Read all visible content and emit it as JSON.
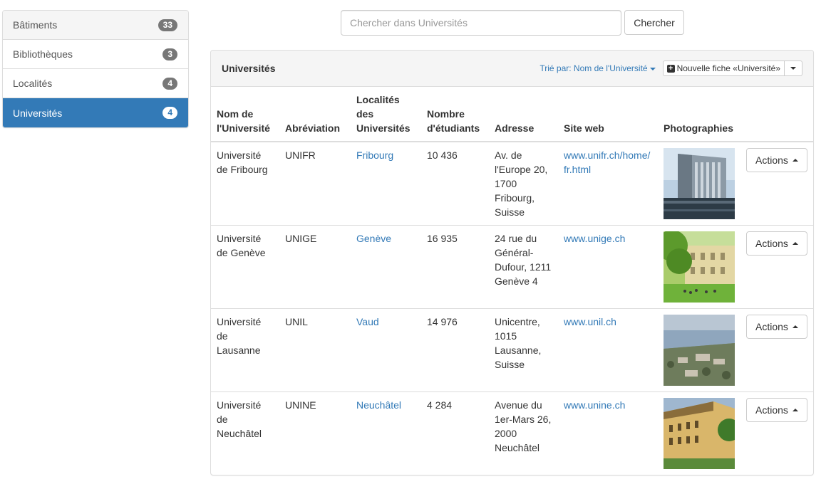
{
  "sidebar": {
    "items": [
      {
        "label": "Bâtiments",
        "count": "33"
      },
      {
        "label": "Bibliothèques",
        "count": "3"
      },
      {
        "label": "Localités",
        "count": "4"
      },
      {
        "label": "Universités",
        "count": "4"
      }
    ],
    "active_index": 3
  },
  "search": {
    "placeholder": "Chercher dans Universités",
    "value": "",
    "button_label": "Chercher"
  },
  "panel": {
    "title": "Universités",
    "sort_label": "Trié par: Nom de l'Université",
    "new_button_label": "Nouvelle fiche «Université»"
  },
  "table": {
    "headers": {
      "name": "Nom de l'Université",
      "abbr": "Abréviation",
      "loc": "Localités des Universités",
      "students": "Nombre d'étudiants",
      "address": "Adresse",
      "website": "Site web",
      "photos": "Photographies"
    },
    "rows": [
      {
        "name": "Université de Fribourg",
        "abbr": "UNIFR",
        "loc": "Fribourg",
        "students": "10 436",
        "address": "Av. de l'Europe 20, 1700 Fribourg, Suisse",
        "website": "www.unifr.ch/home/fr.html",
        "actions": "Actions"
      },
      {
        "name": "Université de Genève",
        "abbr": "UNIGE",
        "loc": "Genève",
        "students": "16 935",
        "address": "24 rue du Général-Dufour, 1211 Genève 4",
        "website": "www.unige.ch",
        "actions": "Actions"
      },
      {
        "name": "Université de Lausanne",
        "abbr": "UNIL",
        "loc": "Vaud",
        "students": "14 976",
        "address": "Unicentre, 1015 Lausanne, Suisse",
        "website": "www.unil.ch",
        "actions": "Actions"
      },
      {
        "name": "Université de Neuchâtel",
        "abbr": "UNINE",
        "loc": "Neuchâtel",
        "students": "4 284",
        "address": "Avenue du 1er-Mars 26, 2000 Neuchâtel",
        "website": "www.unine.ch",
        "actions": "Actions"
      }
    ]
  },
  "colors": {
    "accent": "#337ab7",
    "badge": "#777777",
    "border": "#dddddd",
    "heading_bg": "#f5f5f5"
  },
  "icons": [
    "plus-square-icon",
    "caret-down-icon",
    "caret-up-icon"
  ]
}
